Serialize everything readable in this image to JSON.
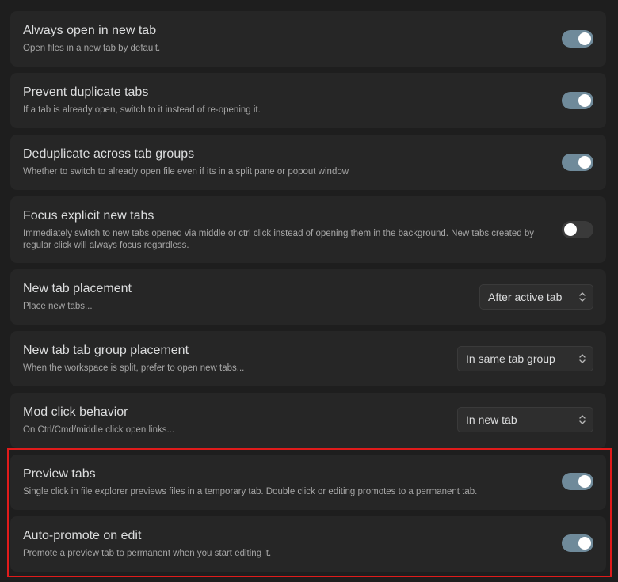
{
  "settings": {
    "items": [
      {
        "title": "Always open in new tab",
        "desc": "Open files in a new tab by default.",
        "control": "toggle",
        "on": true
      },
      {
        "title": "Prevent duplicate tabs",
        "desc": "If a tab is already open, switch to it instead of re-opening it.",
        "control": "toggle",
        "on": true
      },
      {
        "title": "Deduplicate across tab groups",
        "desc": "Whether to switch to already open file even if its in a split pane or popout window",
        "control": "toggle",
        "on": true
      },
      {
        "title": "Focus explicit new tabs",
        "desc": "Immediately switch to new tabs opened via middle or ctrl click instead of opening them in the background. New tabs created by regular click will always focus regardless.",
        "control": "toggle",
        "on": false
      },
      {
        "title": "New tab placement",
        "desc": "Place new tabs...",
        "control": "select",
        "value": "After active tab"
      },
      {
        "title": "New tab tab group placement",
        "desc": "When the workspace is split, prefer to open new tabs...",
        "control": "select",
        "value": "In same tab group"
      },
      {
        "title": "Mod click behavior",
        "desc": "On Ctrl/Cmd/middle click open links...",
        "control": "select",
        "value": "In new tab"
      },
      {
        "title": "Preview tabs",
        "desc": "Single click in file explorer previews files in a temporary tab. Double click or editing promotes to a permanent tab.",
        "control": "toggle",
        "on": true
      },
      {
        "title": "Auto-promote on edit",
        "desc": "Promote a preview tab to permanent when you start editing it.",
        "control": "toggle",
        "on": true
      }
    ]
  },
  "colors": {
    "background": "#1e1e1e",
    "card": "#262626",
    "toggle_on": "#6f8a9a",
    "toggle_off": "#3a3a3a",
    "highlight": "#e01b1b"
  },
  "icons": {
    "select_chevron": "chevron-up-down-icon"
  }
}
